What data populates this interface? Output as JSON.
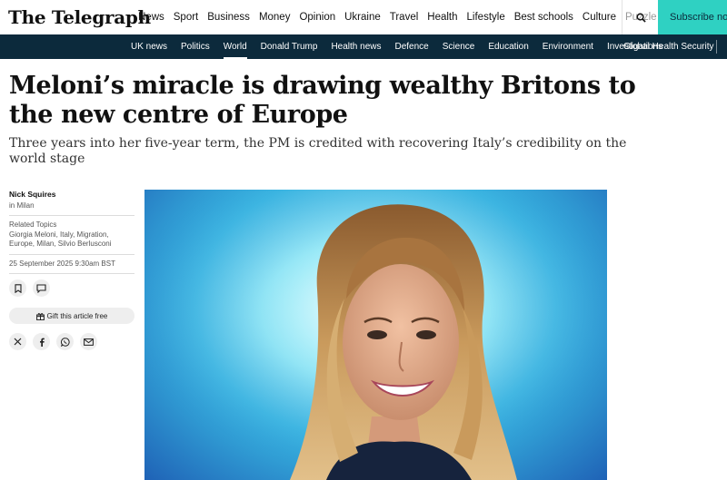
{
  "masthead": {
    "logo": "The Telegraph",
    "nav": [
      "News",
      "Sport",
      "Business",
      "Money",
      "Opinion",
      "Ukraine",
      "Travel",
      "Health",
      "Lifestyle",
      "Best schools",
      "Culture",
      "Puzzle"
    ],
    "search_icon": "search-icon",
    "subscribe": "Subscribe now",
    "accent": "#2fd1c2"
  },
  "subnav": {
    "items": [
      "UK news",
      "Politics",
      "World",
      "Donald Trump",
      "Health news",
      "Defence",
      "Science",
      "Education",
      "Environment",
      "Investigations"
    ],
    "active": "World",
    "right": "Global Health Security",
    "background": "#0c2a3c"
  },
  "article": {
    "headline": "Meloni’s miracle is drawing wealthy Britons to the new centre of Europe",
    "standfirst": "Three years into her five-year term, the PM is credited with recovering Italy’s credibility on the world stage",
    "author": "Nick Squires",
    "location": "in Milan",
    "related_label": "Related Topics",
    "related_topics": "Giorgia Meloni, Italy, Migration, Europe, Milan, Silvio Berlusconi",
    "date": "25 September 2025 9:30am BST",
    "gift_label": "Gift this article free"
  },
  "icons": {
    "save": "bookmark-icon",
    "comments": "comment-icon",
    "gift": "gift-icon",
    "share": [
      "x-icon",
      "facebook-icon",
      "whatsapp-icon",
      "email-icon"
    ]
  }
}
